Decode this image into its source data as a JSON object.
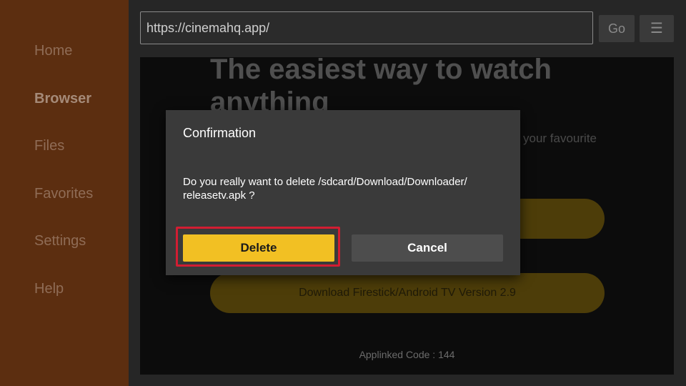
{
  "sidebar": {
    "items": [
      {
        "label": "Home",
        "active": false
      },
      {
        "label": "Browser",
        "active": true
      },
      {
        "label": "Files",
        "active": false
      },
      {
        "label": "Favorites",
        "active": false
      },
      {
        "label": "Settings",
        "active": false
      },
      {
        "label": "Help",
        "active": false
      }
    ]
  },
  "toolbar": {
    "url": "https://cinemahq.app/",
    "go_label": "Go",
    "menu_icon": "hamburger-icon"
  },
  "webpage": {
    "hero_title": "The easiest way to watch anything",
    "hero_subtitle": "your favourite",
    "download_button": "Download Firestick/Android TV Version 2.9",
    "applinked_code": "Applinked Code : 144"
  },
  "dialog": {
    "title": "Confirmation",
    "message": "Do you really want to delete /sdcard/Download/Downloader/ releasetv.apk ?",
    "delete_label": "Delete",
    "cancel_label": "Cancel"
  },
  "colors": {
    "sidebar_bg": "#5c2e10",
    "accent": "#f2c023",
    "highlight": "#d21d32",
    "dialog_bg": "#3a3a3a"
  }
}
